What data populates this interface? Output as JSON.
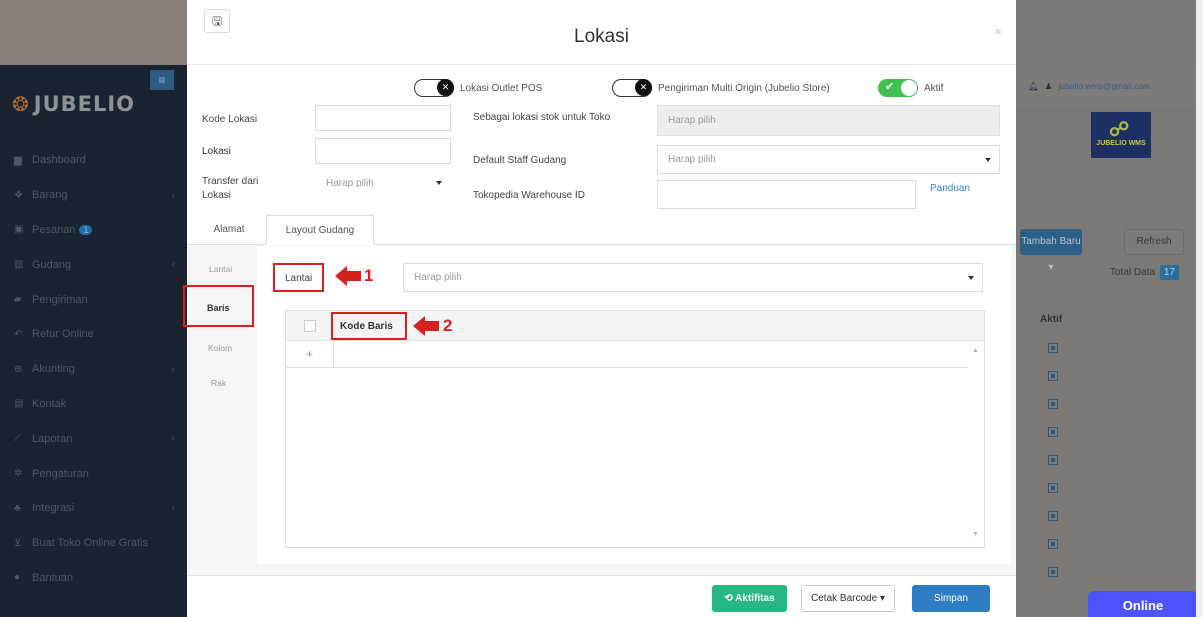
{
  "sidebar": {
    "brand": "JUBELIO",
    "items": [
      {
        "label": "Dashboard",
        "icon": "chart-icon",
        "chevron": false
      },
      {
        "label": "Barang",
        "icon": "box-icon",
        "chevron": true
      },
      {
        "label": "Pesanan",
        "icon": "gift-icon",
        "badge": "1",
        "chevron": false
      },
      {
        "label": "Gudang",
        "icon": "building-icon",
        "chevron": true
      },
      {
        "label": "Pengiriman",
        "icon": "truck-icon",
        "chevron": false
      },
      {
        "label": "Retur Online",
        "icon": "reply-icon",
        "chevron": false
      },
      {
        "label": "Akunting",
        "icon": "money-icon",
        "chevron": true
      },
      {
        "label": "Kontak",
        "icon": "contact-icon",
        "chevron": false
      },
      {
        "label": "Laporan",
        "icon": "line-chart-icon",
        "chevron": true
      },
      {
        "label": "Pengaturan",
        "icon": "gears-icon",
        "chevron": false
      },
      {
        "label": "Integrasi",
        "icon": "sitemap-icon",
        "chevron": true
      },
      {
        "label": "Buat Toko Online Gratis",
        "icon": "cart-icon",
        "chevron": false
      },
      {
        "label": "Bantuan",
        "icon": "question-icon",
        "chevron": false
      }
    ]
  },
  "right_panel": {
    "email": "jubelio.wms@gmail.com",
    "logo_text": "JUBELIO WMS",
    "tambah_label": "Tambah Baru ▾",
    "refresh_label": "Refresh",
    "total_label": "Total Data",
    "total_count": "17",
    "aktif_header": "Aktif",
    "online_label": "Online"
  },
  "modal": {
    "title": "Lokasi",
    "toggles": {
      "outlet_pos": "Lokasi Outlet POS",
      "multi_origin": "Pengiriman Multi Origin (Jubelio Store)",
      "aktif": "Aktif"
    },
    "fields": {
      "kode_lokasi_label": "Kode Lokasi",
      "lokasi_label": "Lokasi",
      "transfer_label_1": "Transfer dari",
      "transfer_label_2": "Lokasi",
      "transfer_placeholder": "Harap pilih",
      "stok_toko_label": "Sebagai lokasi stok untuk Toko",
      "stok_toko_placeholder": "Harap pilih",
      "staff_gudang_label": "Default Staff Gudang",
      "staff_gudang_placeholder": "Harap pilih",
      "tokopedia_label": "Tokopedia Warehouse ID",
      "panduan": "Panduan"
    },
    "tabs": [
      "Alamat",
      "Layout Gudang"
    ],
    "subnav": [
      "Lantai",
      "Baris",
      "Kolom",
      "Rak"
    ],
    "lantai_label": "Lantai",
    "lantai_placeholder": "Harap pilih",
    "grid": {
      "column": "Kode Baris",
      "add_symbol": "+"
    },
    "annotations": [
      "1",
      "2"
    ],
    "footer": {
      "aktifitas": "Aktifitas",
      "cetak_barcode": "Cetak Barcode ▾",
      "simpan": "Simpan"
    }
  },
  "colors": {
    "accent_blue": "#2d7cc4",
    "success_green": "#26b882",
    "toggle_on": "#3fbf4f",
    "highlight_red": "#d82020",
    "online_button": "#4c53ff"
  }
}
